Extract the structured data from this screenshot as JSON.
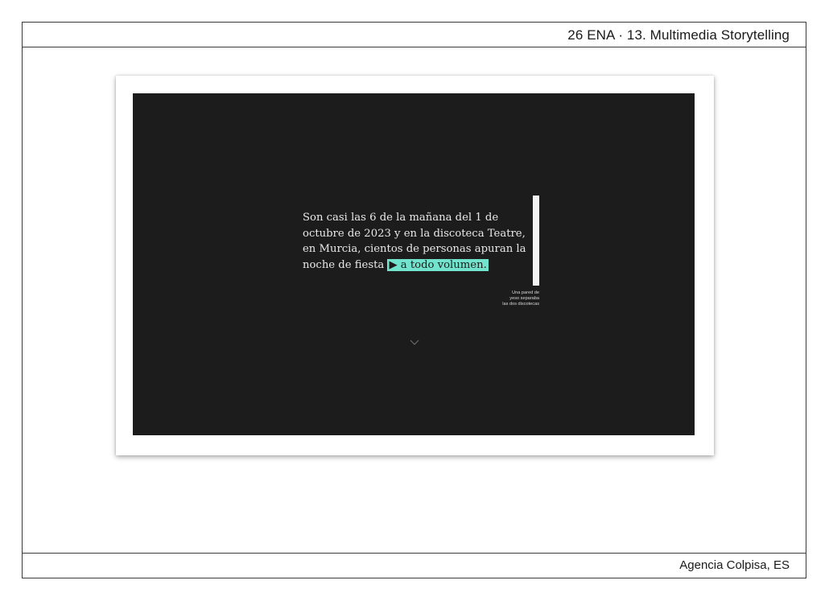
{
  "slide": {
    "header_title": "26 ENA · 13. Multimedia Storytelling",
    "footer_credit": "Agencia Colpisa, ES"
  },
  "story": {
    "lines": [
      "Son casi las 6 de la mañana del 1 de",
      "octubre de 2023 y en la discoteca Teatre,",
      "en Murcia, cientos de personas apuran la",
      "noche de fiesta "
    ],
    "highlight_link": "▶ a todo volumen.",
    "highlight_color": "#72e4cd",
    "background_color": "#1c1c1c"
  },
  "wall_caption": {
    "lines": [
      "Una pared de",
      "yeso separaba",
      "las dos discotecas"
    ]
  },
  "scroll_indicator": {
    "icon": "chevron-down-icon"
  }
}
